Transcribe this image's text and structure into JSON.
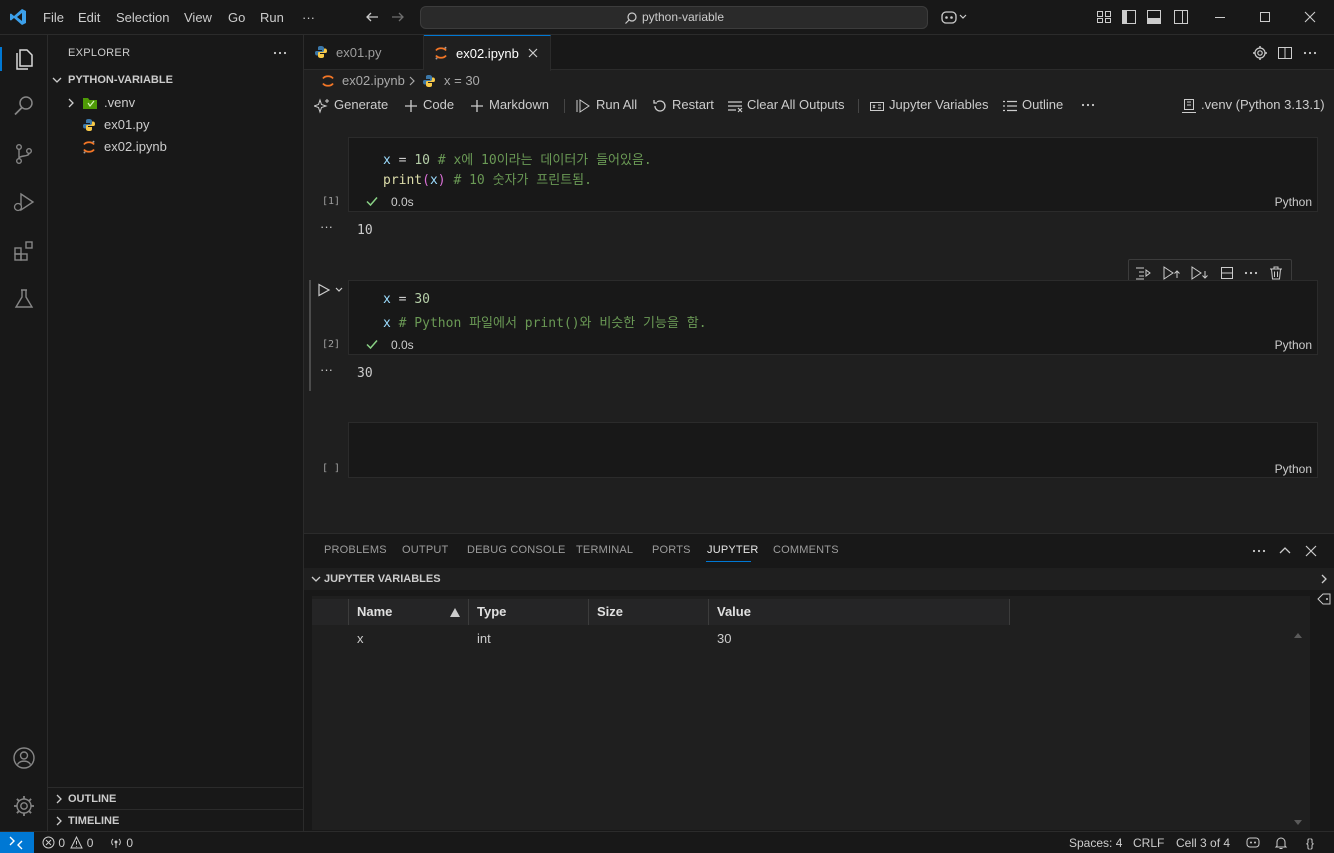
{
  "titlebar": {
    "menu": [
      "File",
      "Edit",
      "Selection",
      "View",
      "Go",
      "Run",
      "···"
    ],
    "search_text": "python-variable"
  },
  "sidebar": {
    "header": "EXPLORER",
    "root": "PYTHON-VARIABLE",
    "items": [
      {
        "label": ".venv",
        "type": "folder"
      },
      {
        "label": "ex01.py",
        "type": "python"
      },
      {
        "label": "ex02.ipynb",
        "type": "notebook"
      }
    ],
    "sections": [
      "OUTLINE",
      "TIMELINE"
    ]
  },
  "tabs": [
    {
      "label": "ex01.py",
      "active": false
    },
    {
      "label": "ex02.ipynb",
      "active": true
    }
  ],
  "breadcrumbs": [
    "ex02.ipynb",
    "x = 30"
  ],
  "notebook_toolbar": {
    "generate": "Generate",
    "code": "Code",
    "markdown": "Markdown",
    "run_all": "Run All",
    "restart": "Restart",
    "clear_outputs": "Clear All Outputs",
    "variables": "Jupyter Variables",
    "outline": "Outline",
    "kernel": ".venv (Python 3.13.1)"
  },
  "cells": [
    {
      "exec_count": "[1]",
      "status_time": "0.0s",
      "language": "Python",
      "output": "10",
      "line1": {
        "var": "x",
        "op": " = ",
        "num": "10",
        "comment": " # x에 10이라는 데이터가 들어있음."
      },
      "line2": {
        "fn": "print",
        "open": "(",
        "var": "x",
        "close": ")",
        "comment": " # 10 숫자가 프린트됨."
      }
    },
    {
      "exec_count": "[2]",
      "status_time": "0.0s",
      "language": "Python",
      "output": "30",
      "line1": {
        "var": "x",
        "op": " = ",
        "num": "30"
      },
      "line2": {
        "var": "x",
        "comment": " # Python 파일에서 print()와 비슷한 기능을 함."
      }
    },
    {
      "exec_count": "[ ]",
      "language": "Python"
    }
  ],
  "panel": {
    "tabs": [
      "PROBLEMS",
      "OUTPUT",
      "DEBUG CONSOLE",
      "TERMINAL",
      "PORTS",
      "JUPYTER",
      "COMMENTS"
    ],
    "active_tab": "JUPYTER",
    "section_title": "JUPYTER VARIABLES",
    "columns": [
      "Name",
      "Type",
      "Size",
      "Value"
    ],
    "rows": [
      {
        "name": "x",
        "type": "int",
        "size": "",
        "value": "30"
      }
    ]
  },
  "statusbar": {
    "errors": "0",
    "warnings": "0",
    "ports": "0",
    "spaces": "Spaces: 4",
    "eol": "CRLF",
    "cell": "Cell 3 of 4",
    "brackets": "{}"
  },
  "colors": {
    "accent": "#0078d4",
    "python_blue": "#3b77a8",
    "python_yellow": "#f7c948",
    "jupyter_orange": "#f37626",
    "success_green": "#89d185"
  }
}
